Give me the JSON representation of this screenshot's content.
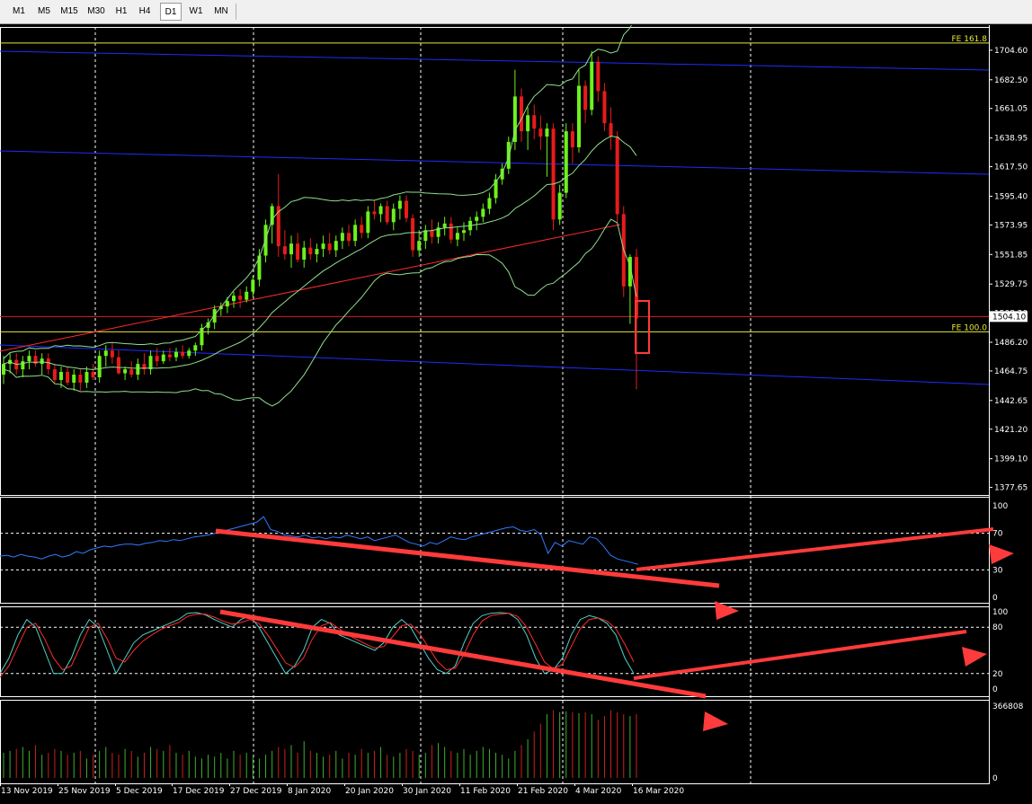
{
  "toolbar": {
    "timeframes": [
      {
        "label": "M1"
      },
      {
        "label": "M5"
      },
      {
        "label": "M15"
      },
      {
        "label": "M30"
      },
      {
        "label": "H1"
      },
      {
        "label": "H4"
      },
      {
        "label": "D1",
        "active": true
      },
      {
        "label": "W1"
      },
      {
        "label": "MN"
      }
    ]
  },
  "chart_data": {
    "type": "candlestick",
    "price_ticks": [
      "1704.60",
      "1682.50",
      "1661.05",
      "1638.95",
      "1617.50",
      "1595.40",
      "1573.95",
      "1551.85",
      "1529.75",
      "1508.20",
      "1486.20",
      "1464.75",
      "1442.65",
      "1421.20",
      "1399.10",
      "1377.65"
    ],
    "price_range": [
      1372,
      1722
    ],
    "current_price": "1504.10",
    "fib_levels": [
      {
        "label": "FE 161.8",
        "price": 1710
      },
      {
        "label": "FE 100.0",
        "price": 1494
      }
    ],
    "date_labels": [
      "13 Nov 2019",
      "25 Nov 2019",
      "5 Dec 2019",
      "17 Dec 2019",
      "27 Dec 2019",
      "8 Jan 2020",
      "20 Jan 2020",
      "30 Jan 2020",
      "11 Feb 2020",
      "21 Feb 2020",
      "4 Mar 2020",
      "16 Mar 2020"
    ],
    "candles": [
      {
        "o": 1462,
        "h": 1476,
        "l": 1455,
        "c": 1470
      },
      {
        "o": 1470,
        "h": 1478,
        "l": 1463,
        "c": 1473
      },
      {
        "o": 1473,
        "h": 1478,
        "l": 1462,
        "c": 1466
      },
      {
        "o": 1466,
        "h": 1476,
        "l": 1460,
        "c": 1472
      },
      {
        "o": 1472,
        "h": 1480,
        "l": 1466,
        "c": 1476
      },
      {
        "o": 1476,
        "h": 1480,
        "l": 1468,
        "c": 1470
      },
      {
        "o": 1470,
        "h": 1478,
        "l": 1462,
        "c": 1474
      },
      {
        "o": 1474,
        "h": 1478,
        "l": 1462,
        "c": 1466
      },
      {
        "o": 1466,
        "h": 1470,
        "l": 1455,
        "c": 1458
      },
      {
        "o": 1458,
        "h": 1468,
        "l": 1452,
        "c": 1464
      },
      {
        "o": 1464,
        "h": 1468,
        "l": 1454,
        "c": 1456
      },
      {
        "o": 1456,
        "h": 1466,
        "l": 1450,
        "c": 1462
      },
      {
        "o": 1462,
        "h": 1466,
        "l": 1450,
        "c": 1456
      },
      {
        "o": 1456,
        "h": 1468,
        "l": 1452,
        "c": 1464
      },
      {
        "o": 1464,
        "h": 1470,
        "l": 1458,
        "c": 1460
      },
      {
        "o": 1460,
        "h": 1480,
        "l": 1456,
        "c": 1476
      },
      {
        "o": 1476,
        "h": 1484,
        "l": 1468,
        "c": 1480
      },
      {
        "o": 1480,
        "h": 1486,
        "l": 1470,
        "c": 1475
      },
      {
        "o": 1475,
        "h": 1480,
        "l": 1462,
        "c": 1463
      },
      {
        "o": 1463,
        "h": 1468,
        "l": 1458,
        "c": 1466
      },
      {
        "o": 1466,
        "h": 1472,
        "l": 1460,
        "c": 1462
      },
      {
        "o": 1462,
        "h": 1474,
        "l": 1458,
        "c": 1470
      },
      {
        "o": 1470,
        "h": 1478,
        "l": 1462,
        "c": 1466
      },
      {
        "o": 1466,
        "h": 1480,
        "l": 1462,
        "c": 1476
      },
      {
        "o": 1476,
        "h": 1482,
        "l": 1468,
        "c": 1472
      },
      {
        "o": 1472,
        "h": 1480,
        "l": 1470,
        "c": 1477
      },
      {
        "o": 1477,
        "h": 1482,
        "l": 1472,
        "c": 1475
      },
      {
        "o": 1475,
        "h": 1482,
        "l": 1472,
        "c": 1479
      },
      {
        "o": 1479,
        "h": 1484,
        "l": 1474,
        "c": 1476
      },
      {
        "o": 1476,
        "h": 1482,
        "l": 1474,
        "c": 1480
      },
      {
        "o": 1480,
        "h": 1486,
        "l": 1476,
        "c": 1484
      },
      {
        "o": 1484,
        "h": 1500,
        "l": 1480,
        "c": 1497
      },
      {
        "o": 1497,
        "h": 1504,
        "l": 1492,
        "c": 1501
      },
      {
        "o": 1501,
        "h": 1514,
        "l": 1496,
        "c": 1511
      },
      {
        "o": 1511,
        "h": 1516,
        "l": 1506,
        "c": 1513
      },
      {
        "o": 1513,
        "h": 1520,
        "l": 1508,
        "c": 1517
      },
      {
        "o": 1517,
        "h": 1524,
        "l": 1512,
        "c": 1521
      },
      {
        "o": 1521,
        "h": 1526,
        "l": 1512,
        "c": 1518
      },
      {
        "o": 1518,
        "h": 1528,
        "l": 1516,
        "c": 1524
      },
      {
        "o": 1524,
        "h": 1536,
        "l": 1520,
        "c": 1533
      },
      {
        "o": 1533,
        "h": 1556,
        "l": 1528,
        "c": 1551
      },
      {
        "o": 1551,
        "h": 1578,
        "l": 1546,
        "c": 1574
      },
      {
        "o": 1574,
        "h": 1590,
        "l": 1560,
        "c": 1588
      },
      {
        "o": 1588,
        "h": 1612,
        "l": 1550,
        "c": 1558
      },
      {
        "o": 1558,
        "h": 1570,
        "l": 1548,
        "c": 1552
      },
      {
        "o": 1552,
        "h": 1566,
        "l": 1542,
        "c": 1560
      },
      {
        "o": 1560,
        "h": 1568,
        "l": 1546,
        "c": 1548
      },
      {
        "o": 1548,
        "h": 1562,
        "l": 1542,
        "c": 1557
      },
      {
        "o": 1557,
        "h": 1564,
        "l": 1548,
        "c": 1552
      },
      {
        "o": 1552,
        "h": 1560,
        "l": 1546,
        "c": 1556
      },
      {
        "o": 1556,
        "h": 1566,
        "l": 1550,
        "c": 1560
      },
      {
        "o": 1560,
        "h": 1568,
        "l": 1552,
        "c": 1555
      },
      {
        "o": 1555,
        "h": 1566,
        "l": 1550,
        "c": 1562
      },
      {
        "o": 1562,
        "h": 1572,
        "l": 1556,
        "c": 1568
      },
      {
        "o": 1568,
        "h": 1574,
        "l": 1558,
        "c": 1562
      },
      {
        "o": 1562,
        "h": 1578,
        "l": 1558,
        "c": 1574
      },
      {
        "o": 1574,
        "h": 1580,
        "l": 1564,
        "c": 1568
      },
      {
        "o": 1568,
        "h": 1588,
        "l": 1564,
        "c": 1584
      },
      {
        "o": 1584,
        "h": 1592,
        "l": 1578,
        "c": 1582
      },
      {
        "o": 1582,
        "h": 1590,
        "l": 1576,
        "c": 1588
      },
      {
        "o": 1588,
        "h": 1592,
        "l": 1574,
        "c": 1576
      },
      {
        "o": 1576,
        "h": 1590,
        "l": 1570,
        "c": 1586
      },
      {
        "o": 1586,
        "h": 1596,
        "l": 1578,
        "c": 1592
      },
      {
        "o": 1592,
        "h": 1596,
        "l": 1576,
        "c": 1579
      },
      {
        "o": 1579,
        "h": 1582,
        "l": 1550,
        "c": 1555
      },
      {
        "o": 1555,
        "h": 1570,
        "l": 1550,
        "c": 1562
      },
      {
        "o": 1562,
        "h": 1574,
        "l": 1556,
        "c": 1570
      },
      {
        "o": 1570,
        "h": 1578,
        "l": 1560,
        "c": 1565
      },
      {
        "o": 1565,
        "h": 1576,
        "l": 1560,
        "c": 1572
      },
      {
        "o": 1572,
        "h": 1580,
        "l": 1566,
        "c": 1575
      },
      {
        "o": 1575,
        "h": 1580,
        "l": 1560,
        "c": 1563
      },
      {
        "o": 1563,
        "h": 1572,
        "l": 1558,
        "c": 1568
      },
      {
        "o": 1568,
        "h": 1576,
        "l": 1562,
        "c": 1570
      },
      {
        "o": 1570,
        "h": 1580,
        "l": 1566,
        "c": 1577
      },
      {
        "o": 1577,
        "h": 1584,
        "l": 1570,
        "c": 1580
      },
      {
        "o": 1580,
        "h": 1590,
        "l": 1576,
        "c": 1586
      },
      {
        "o": 1586,
        "h": 1598,
        "l": 1582,
        "c": 1594
      },
      {
        "o": 1594,
        "h": 1612,
        "l": 1590,
        "c": 1608
      },
      {
        "o": 1608,
        "h": 1620,
        "l": 1604,
        "c": 1616
      },
      {
        "o": 1616,
        "h": 1640,
        "l": 1612,
        "c": 1636
      },
      {
        "o": 1636,
        "h": 1690,
        "l": 1630,
        "c": 1670
      },
      {
        "o": 1670,
        "h": 1676,
        "l": 1636,
        "c": 1644
      },
      {
        "o": 1644,
        "h": 1662,
        "l": 1630,
        "c": 1656
      },
      {
        "o": 1656,
        "h": 1664,
        "l": 1638,
        "c": 1646
      },
      {
        "o": 1646,
        "h": 1656,
        "l": 1630,
        "c": 1640
      },
      {
        "o": 1640,
        "h": 1650,
        "l": 1610,
        "c": 1646
      },
      {
        "o": 1646,
        "h": 1650,
        "l": 1570,
        "c": 1578
      },
      {
        "o": 1578,
        "h": 1604,
        "l": 1574,
        "c": 1598
      },
      {
        "o": 1598,
        "h": 1650,
        "l": 1594,
        "c": 1644
      },
      {
        "o": 1644,
        "h": 1650,
        "l": 1620,
        "c": 1632
      },
      {
        "o": 1632,
        "h": 1690,
        "l": 1628,
        "c": 1678
      },
      {
        "o": 1678,
        "h": 1682,
        "l": 1650,
        "c": 1660
      },
      {
        "o": 1660,
        "h": 1704,
        "l": 1656,
        "c": 1696
      },
      {
        "o": 1696,
        "h": 1700,
        "l": 1666,
        "c": 1674
      },
      {
        "o": 1674,
        "h": 1680,
        "l": 1644,
        "c": 1650
      },
      {
        "o": 1650,
        "h": 1662,
        "l": 1630,
        "c": 1640
      },
      {
        "o": 1640,
        "h": 1644,
        "l": 1576,
        "c": 1582
      },
      {
        "o": 1582,
        "h": 1588,
        "l": 1520,
        "c": 1528
      },
      {
        "o": 1528,
        "h": 1552,
        "l": 1500,
        "c": 1550
      },
      {
        "o": 1550,
        "h": 1556,
        "l": 1451,
        "c": 1504
      }
    ],
    "rsi": {
      "levels": [
        "100",
        "70",
        "30",
        "0"
      ],
      "values": [
        45,
        46,
        44,
        47,
        45,
        44,
        42,
        45,
        47,
        44,
        46,
        50,
        48,
        52,
        54,
        56,
        55,
        57,
        58,
        58,
        57,
        59,
        60,
        62,
        61,
        63,
        62,
        64,
        66,
        67,
        68,
        70,
        72,
        74,
        76,
        78,
        80,
        82,
        88,
        74,
        72,
        68,
        67,
        66,
        68,
        65,
        66,
        64,
        66,
        65,
        68,
        66,
        64,
        66,
        62,
        64,
        66,
        68,
        64,
        60,
        58,
        56,
        60,
        58,
        62,
        66,
        64,
        63,
        66,
        68,
        70,
        72,
        74,
        76,
        77,
        73,
        72,
        74,
        68,
        48,
        60,
        56,
        62,
        60,
        58,
        66,
        64,
        56,
        46,
        42,
        40,
        38,
        36
      ]
    },
    "stochastic": {
      "levels": [
        "100",
        "80",
        "20",
        "0"
      ],
      "main": [
        20,
        40,
        70,
        90,
        80,
        50,
        20,
        20,
        40,
        70,
        90,
        80,
        50,
        20,
        40,
        60,
        70,
        75,
        80,
        85,
        90,
        98,
        99,
        96,
        90,
        85,
        80,
        90,
        95,
        80,
        60,
        40,
        20,
        30,
        50,
        80,
        90,
        85,
        70,
        65,
        60,
        55,
        50,
        60,
        80,
        90,
        80,
        60,
        40,
        25,
        20,
        30,
        60,
        85,
        95,
        98,
        99,
        98,
        90,
        70,
        40,
        20,
        25,
        40,
        70,
        90,
        95,
        92,
        85,
        70,
        40,
        20
      ],
      "signal": [
        15,
        30,
        55,
        80,
        85,
        65,
        40,
        25,
        30,
        55,
        80,
        85,
        65,
        40,
        35,
        50,
        62,
        70,
        77,
        82,
        86,
        94,
        97,
        97,
        93,
        88,
        84,
        86,
        90,
        85,
        70,
        52,
        34,
        28,
        40,
        65,
        82,
        86,
        78,
        70,
        64,
        58,
        53,
        55,
        68,
        82,
        84,
        72,
        54,
        36,
        25,
        27,
        45,
        70,
        88,
        95,
        97,
        98,
        94,
        80,
        58,
        35,
        26,
        32,
        55,
        78,
        90,
        92,
        88,
        78,
        58,
        35
      ]
    },
    "volume": {
      "label": "366808",
      "zero": "0",
      "max": 366808,
      "values": [
        130000,
        140000,
        150000,
        160000,
        140000,
        170000,
        120000,
        130000,
        150000,
        140000,
        120000,
        130000,
        140000,
        100000,
        120000,
        140000,
        160000,
        130000,
        120000,
        150000,
        140000,
        110000,
        130000,
        160000,
        150000,
        140000,
        170000,
        130000,
        120000,
        140000,
        110000,
        100000,
        120000,
        110000,
        130000,
        100000,
        140000,
        120000,
        130000,
        110000,
        100000,
        120000,
        140000,
        160000,
        150000,
        170000,
        130000,
        190000,
        140000,
        130000,
        110000,
        120000,
        140000,
        100000,
        130000,
        120000,
        150000,
        130000,
        140000,
        160000,
        120000,
        110000,
        130000,
        150000,
        140000,
        120000,
        130000,
        170000,
        180000,
        160000,
        140000,
        130000,
        150000,
        120000,
        140000,
        160000,
        150000,
        130000,
        120000,
        100000,
        140000,
        170000,
        200000,
        240000,
        280000,
        330000,
        350000,
        340000,
        345000,
        340000,
        335000,
        340000,
        330000,
        300000,
        320000,
        350000,
        340000,
        330000,
        320000,
        330000,
        310000,
        325000,
        320000
      ]
    }
  }
}
